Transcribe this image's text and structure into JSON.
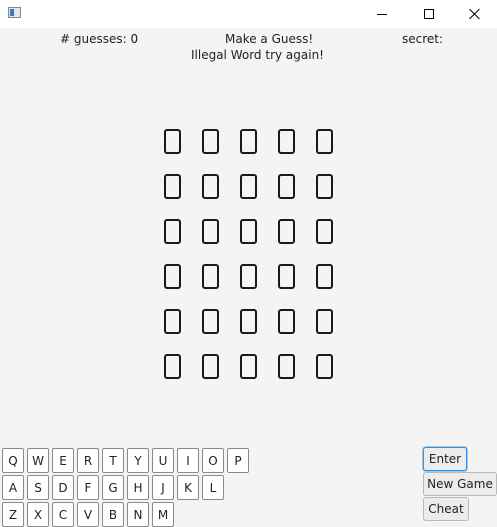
{
  "window": {
    "icon": "app-window-icon",
    "controls": [
      "minimize-icon",
      "maximize-icon",
      "close-icon"
    ]
  },
  "status": {
    "guesses": "# guesses: 0",
    "prompt": "Make a Guess!",
    "secret": "secret:",
    "message": "Illegal Word try again!"
  },
  "board": {
    "rows": 6,
    "cols": 5,
    "tiles": [
      [
        "",
        "",
        "",
        "",
        ""
      ],
      [
        "",
        "",
        "",
        "",
        ""
      ],
      [
        "",
        "",
        "",
        "",
        ""
      ],
      [
        "",
        "",
        "",
        "",
        ""
      ],
      [
        "",
        "",
        "",
        "",
        ""
      ],
      [
        "",
        "",
        "",
        "",
        ""
      ]
    ]
  },
  "keyboard": {
    "row1": [
      "Q",
      "W",
      "E",
      "R",
      "T",
      "Y",
      "U",
      "I",
      "O",
      "P"
    ],
    "row2": [
      "A",
      "S",
      "D",
      "F",
      "G",
      "H",
      "J",
      "K",
      "L"
    ],
    "row3": [
      "Z",
      "X",
      "C",
      "V",
      "B",
      "N",
      "M"
    ]
  },
  "actions": {
    "enter": "Enter",
    "new_game": "New Game",
    "cheat": "Cheat"
  }
}
